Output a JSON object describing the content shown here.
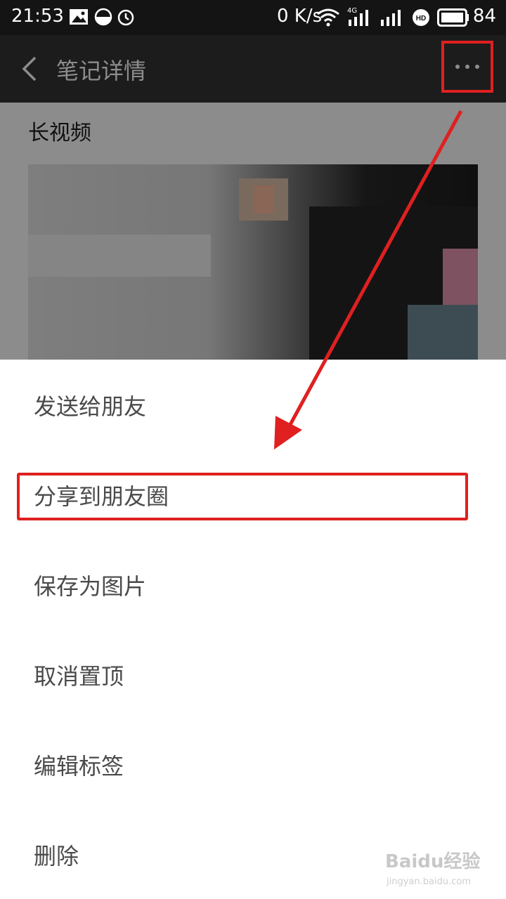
{
  "status_bar": {
    "time": "21:53",
    "net_speed": "0 K/s",
    "network": "4G",
    "battery": "84",
    "icons": [
      "image-icon",
      "data-saver-icon",
      "alarm-icon",
      "wifi-icon",
      "signal-icon",
      "hd-icon",
      "battery-icon"
    ]
  },
  "appbar": {
    "title": "笔记详情",
    "back_icon": "chevron-left-icon",
    "more_icon": "more-dots-icon"
  },
  "note": {
    "title": "长视频"
  },
  "menu": {
    "items": [
      {
        "label": "发送给朋友"
      },
      {
        "label": "分享到朋友圈"
      },
      {
        "label": "保存为图片"
      },
      {
        "label": "取消置顶"
      },
      {
        "label": "编辑标签"
      },
      {
        "label": "删除"
      }
    ]
  },
  "watermark": {
    "brand": "Baidu经验",
    "site": "jingyan.baidu.com"
  },
  "colors": {
    "highlight": "#e02020",
    "menu_text": "#4a4a4a",
    "appbar_bg": "#1c1c1c"
  }
}
